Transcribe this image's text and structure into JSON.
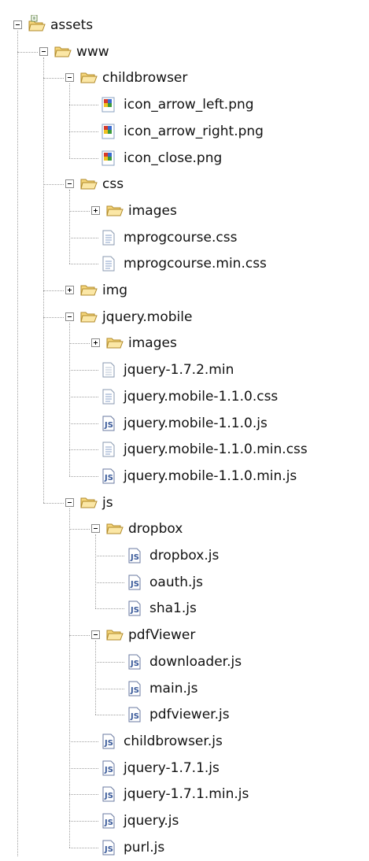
{
  "tree": [
    {
      "label": "assets",
      "icon": "source-folder",
      "depth": 0,
      "expander": "minus"
    },
    {
      "label": "www",
      "icon": "folder",
      "depth": 1,
      "expander": "minus"
    },
    {
      "label": "childbrowser",
      "icon": "folder",
      "depth": 2,
      "expander": "minus"
    },
    {
      "label": "icon_arrow_left.png",
      "icon": "png-file",
      "depth": 3,
      "expander": "none"
    },
    {
      "label": "icon_arrow_right.png",
      "icon": "png-file",
      "depth": 3,
      "expander": "none"
    },
    {
      "label": "icon_close.png",
      "icon": "png-file",
      "depth": 3,
      "expander": "none"
    },
    {
      "label": "css",
      "icon": "folder",
      "depth": 2,
      "expander": "minus"
    },
    {
      "label": "images",
      "icon": "folder",
      "depth": 3,
      "expander": "plus"
    },
    {
      "label": "mprogcourse.css",
      "icon": "css-file",
      "depth": 3,
      "expander": "none"
    },
    {
      "label": "mprogcourse.min.css",
      "icon": "css-file",
      "depth": 3,
      "expander": "none"
    },
    {
      "label": "img",
      "icon": "folder",
      "depth": 2,
      "expander": "plus"
    },
    {
      "label": "jquery.mobile",
      "icon": "folder",
      "depth": 2,
      "expander": "minus"
    },
    {
      "label": "images",
      "icon": "folder",
      "depth": 3,
      "expander": "plus"
    },
    {
      "label": "jquery-1.7.2.min",
      "icon": "text-file",
      "depth": 3,
      "expander": "none"
    },
    {
      "label": "jquery.mobile-1.1.0.css",
      "icon": "css-file",
      "depth": 3,
      "expander": "none"
    },
    {
      "label": "jquery.mobile-1.1.0.js",
      "icon": "js-file",
      "depth": 3,
      "expander": "none"
    },
    {
      "label": "jquery.mobile-1.1.0.min.css",
      "icon": "css-file",
      "depth": 3,
      "expander": "none"
    },
    {
      "label": "jquery.mobile-1.1.0.min.js",
      "icon": "js-file",
      "depth": 3,
      "expander": "none"
    },
    {
      "label": "js",
      "icon": "folder",
      "depth": 2,
      "expander": "minus"
    },
    {
      "label": "dropbox",
      "icon": "folder",
      "depth": 3,
      "expander": "minus"
    },
    {
      "label": "dropbox.js",
      "icon": "js-file",
      "depth": 4,
      "expander": "none"
    },
    {
      "label": "oauth.js",
      "icon": "js-file",
      "depth": 4,
      "expander": "none"
    },
    {
      "label": "sha1.js",
      "icon": "js-file",
      "depth": 4,
      "expander": "none"
    },
    {
      "label": "pdfViewer",
      "icon": "folder",
      "depth": 3,
      "expander": "minus"
    },
    {
      "label": "downloader.js",
      "icon": "js-file",
      "depth": 4,
      "expander": "none"
    },
    {
      "label": "main.js",
      "icon": "js-file",
      "depth": 4,
      "expander": "none"
    },
    {
      "label": "pdfviewer.js",
      "icon": "js-file",
      "depth": 4,
      "expander": "none"
    },
    {
      "label": "childbrowser.js",
      "icon": "js-file",
      "depth": 3,
      "expander": "none"
    },
    {
      "label": "jquery-1.7.1.js",
      "icon": "js-file",
      "depth": 3,
      "expander": "none"
    },
    {
      "label": "jquery-1.7.1.min.js",
      "icon": "js-file",
      "depth": 3,
      "expander": "none"
    },
    {
      "label": "jquery.js",
      "icon": "js-file",
      "depth": 3,
      "expander": "none"
    },
    {
      "label": "purl.js",
      "icon": "js-file",
      "depth": 3,
      "expander": "none"
    }
  ]
}
